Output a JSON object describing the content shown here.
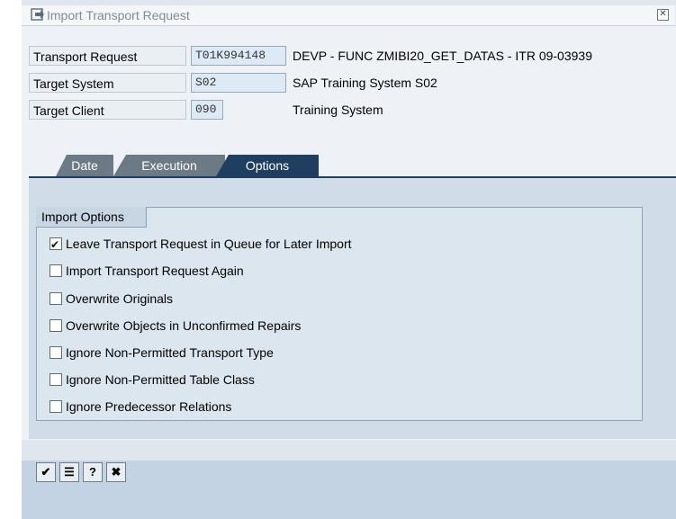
{
  "window": {
    "title": "Import Transport Request"
  },
  "header": {
    "transport_request_label": "Transport Request",
    "transport_request_value": "T01K994148",
    "transport_request_desc": "DEVP - FUNC ZMIBI20_GET_DATAS - ITR 09-03939",
    "target_system_label": "Target System",
    "target_system_value": "S02",
    "target_system_desc": "SAP Training System S02",
    "target_client_label": "Target Client",
    "target_client_value": "090",
    "target_client_desc": "Training System"
  },
  "tabs": [
    {
      "label": "Date"
    },
    {
      "label": "Execution"
    },
    {
      "label": "Options"
    }
  ],
  "import_options": {
    "title": "Import Options",
    "items": [
      {
        "label": "Leave Transport Request in Queue for Later Import",
        "checked": true
      },
      {
        "label": "Import Transport Request Again",
        "checked": false
      },
      {
        "label": "Overwrite Originals",
        "checked": false
      },
      {
        "label": "Overwrite Objects in Unconfirmed Repairs",
        "checked": false
      },
      {
        "label": "Ignore Non-Permitted Transport Type",
        "checked": false
      },
      {
        "label": "Ignore Non-Permitted Table Class",
        "checked": false
      },
      {
        "label": "Ignore Predecessor Relations",
        "checked": false
      }
    ]
  },
  "toolbar": {
    "buttons": [
      {
        "icon": "checkmark-icon",
        "glyph": "✔"
      },
      {
        "icon": "list-icon",
        "glyph": "☰"
      },
      {
        "icon": "help-icon",
        "glyph": "?"
      },
      {
        "icon": "cancel-icon",
        "glyph": "✖"
      }
    ]
  }
}
